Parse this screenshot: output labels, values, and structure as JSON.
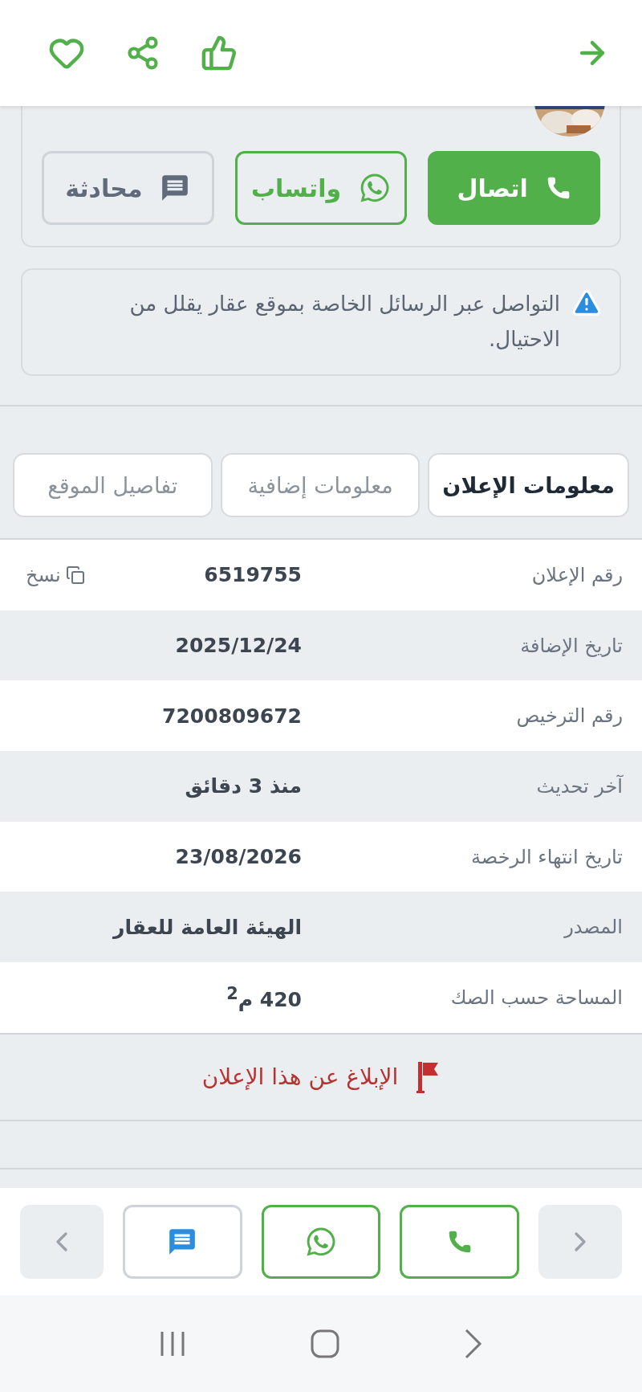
{
  "contact_buttons": [
    {
      "kind": "call",
      "label": "اتصال"
    },
    {
      "kind": "whatsapp",
      "label": "واتساب"
    },
    {
      "kind": "chat",
      "label": "محادثة"
    }
  ],
  "warning": {
    "text": "التواصل عبر الرسائل الخاصة بموقع عقار يقلل من الاحتيال."
  },
  "tabs": [
    {
      "label": "معلومات الإعلان",
      "selected": true
    },
    {
      "label": "معلومات إضافية",
      "selected": false
    },
    {
      "label": "تفاصيل الموقع",
      "selected": false
    }
  ],
  "details": [
    {
      "label": "رقم الإعلان",
      "value": "6519755",
      "action": "نسخ"
    },
    {
      "label": "تاريخ الإضافة",
      "value": "2025/12/24"
    },
    {
      "label": "رقم الترخيص",
      "value": "7200809672"
    },
    {
      "label": "آخر تحديث",
      "value": "منذ 3 دقائق"
    },
    {
      "label": "تاريخ انتهاء الرخصة",
      "value": "23/08/2026"
    },
    {
      "label": "المصدر",
      "value": "الهيئة العامة للعقار"
    },
    {
      "label": "المساحة حسب الصك",
      "value": "420 م$^{2}$"
    }
  ],
  "report": {
    "label": "الإبلاغ عن هذا الإعلان"
  }
}
